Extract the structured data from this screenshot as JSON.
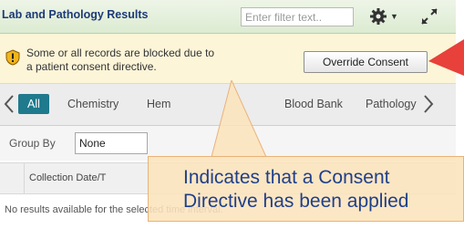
{
  "header": {
    "title": "Lab and Pathology Results",
    "filter_placeholder": "Enter filter text..",
    "gear_icon": "gear-icon",
    "expand_icon": "expand-icon"
  },
  "consent": {
    "message_line1": "Some or all records are blocked due to",
    "message_line2": "a patient consent directive.",
    "override_label": "Override Consent",
    "shield_icon": "shield-icon"
  },
  "tabs": [
    {
      "label": "All",
      "active": true
    },
    {
      "label": "Chemistry",
      "active": false
    },
    {
      "label": "Hem",
      "active": false
    },
    {
      "label": "Blood Bank",
      "active": false
    },
    {
      "label": "Pathology",
      "active": false
    }
  ],
  "group_by": {
    "label": "Group By",
    "value": "None"
  },
  "grid": {
    "column_header": "Collection Date/T",
    "empty_message": "No results available for the selected time interval."
  },
  "callout": {
    "line1": "Indicates that a Consent",
    "line2": "Directive has been applied"
  },
  "colors": {
    "accent": "#1e7a8c",
    "title": "#1d3a78",
    "consent_bg": "#fcf5d8",
    "callout_bg": "#fce4bc",
    "arrow": "#e8403a"
  }
}
